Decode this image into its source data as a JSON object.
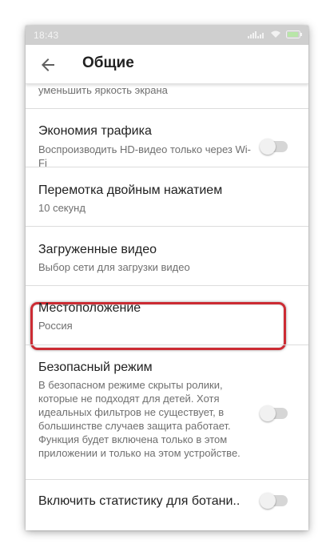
{
  "status_bar": {
    "time": "18:43"
  },
  "app_bar": {
    "title": "Общие",
    "back_icon": "arrow-back-icon"
  },
  "settings": {
    "partial_item": {
      "subtitle": "уменьшить яркость экрана"
    },
    "items": [
      {
        "title": "Экономия трафика",
        "subtitle": "Воспроизводить HD-видео только через Wi-Fi",
        "toggle": false
      },
      {
        "title": "Перемотка двойным нажатием",
        "subtitle": "10 секунд"
      },
      {
        "title": "Загруженные видео",
        "subtitle": "Выбор сети для загрузки видео"
      },
      {
        "title": "Местоположение",
        "subtitle": "Россия"
      },
      {
        "title": "Безопасный режим",
        "subtitle": "В безопасном режиме скрыты ролики, которые не подходят для детей. Хотя идеальных фильтров не существует, в большинстве случаев защита работает. Функция будет включена только в этом приложении и только на этом устройстве.",
        "toggle": false
      },
      {
        "title": "Включить статистику для ботани..",
        "toggle": false
      }
    ]
  },
  "colors": {
    "highlight": "#cc2b33",
    "status_bar": "#cfcfcf",
    "toggle_track": "#d6d6d6"
  }
}
